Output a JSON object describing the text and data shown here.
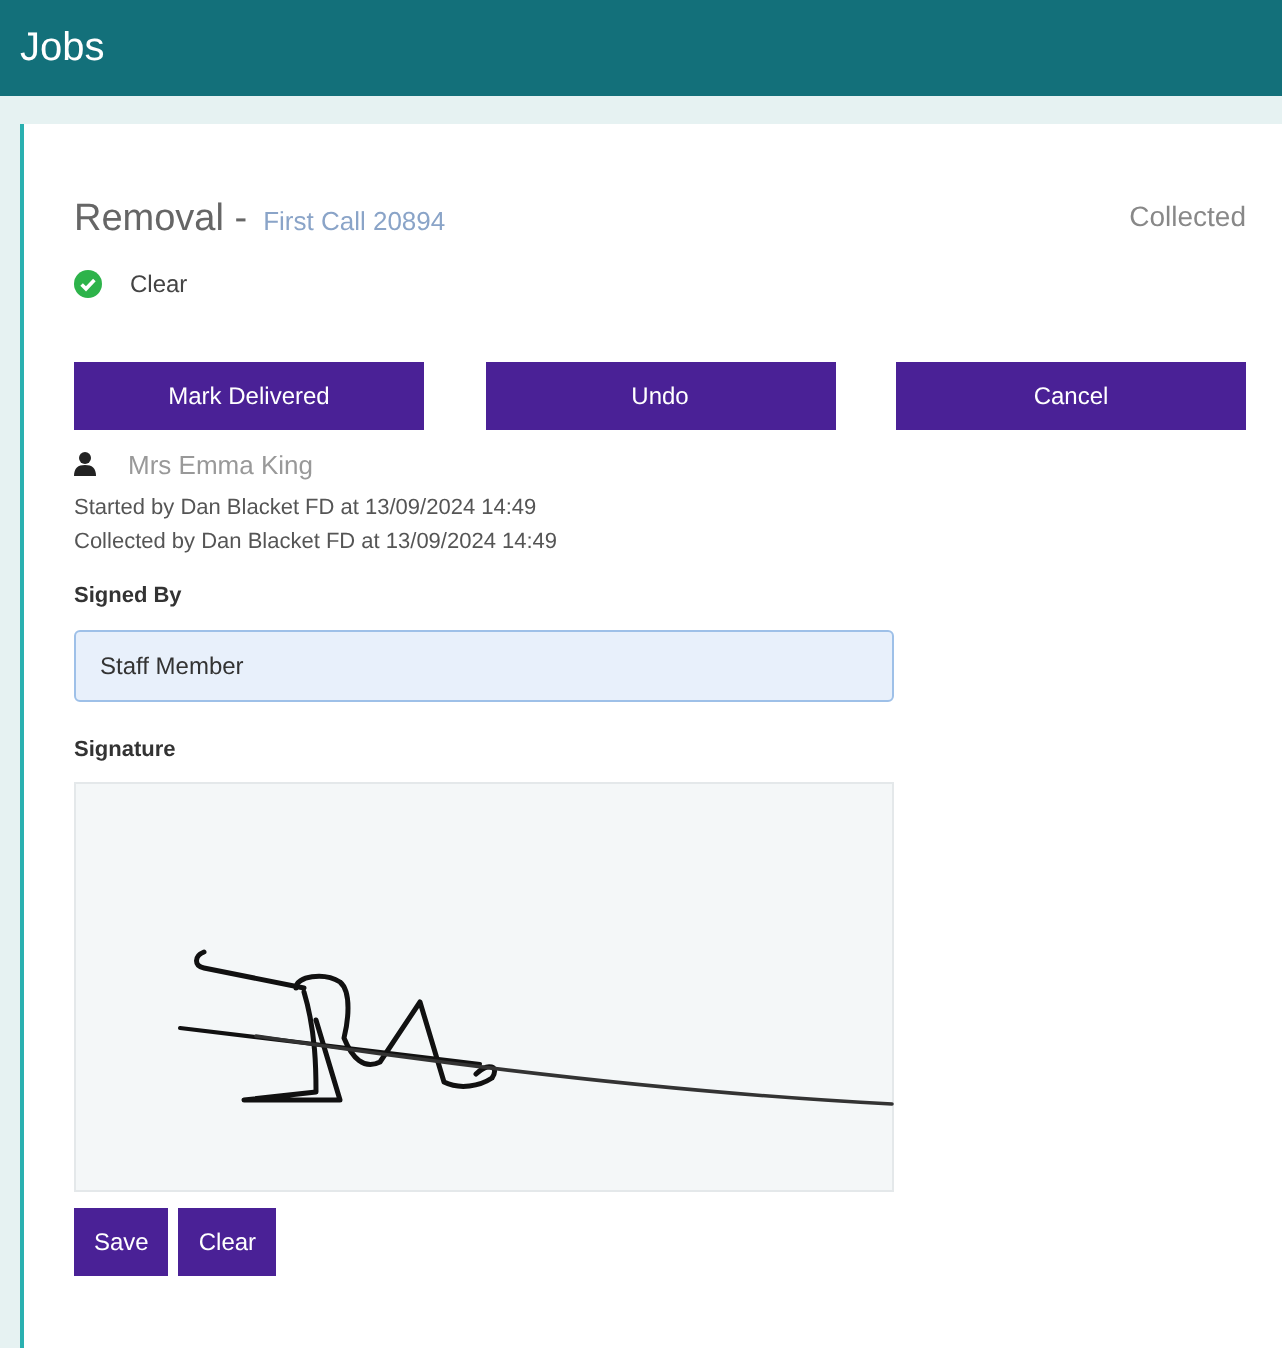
{
  "header": {
    "title": "Jobs"
  },
  "job": {
    "type": "Removal -",
    "reference": "First Call 20894",
    "stage": "Collected",
    "status": "Clear"
  },
  "actions": [
    "Mark Delivered",
    "Undo",
    "Cancel"
  ],
  "person": "Mrs Emma King",
  "history": [
    "Started by Dan Blacket FD at 13/09/2024 14:49",
    "Collected by Dan Blacket FD at 13/09/2024 14:49"
  ],
  "signed_by": {
    "label": "Signed By",
    "value": "Staff Member",
    "focused": true
  },
  "signature": {
    "label": "Signature"
  },
  "signature_buttons": [
    "Save",
    "Clear"
  ]
}
